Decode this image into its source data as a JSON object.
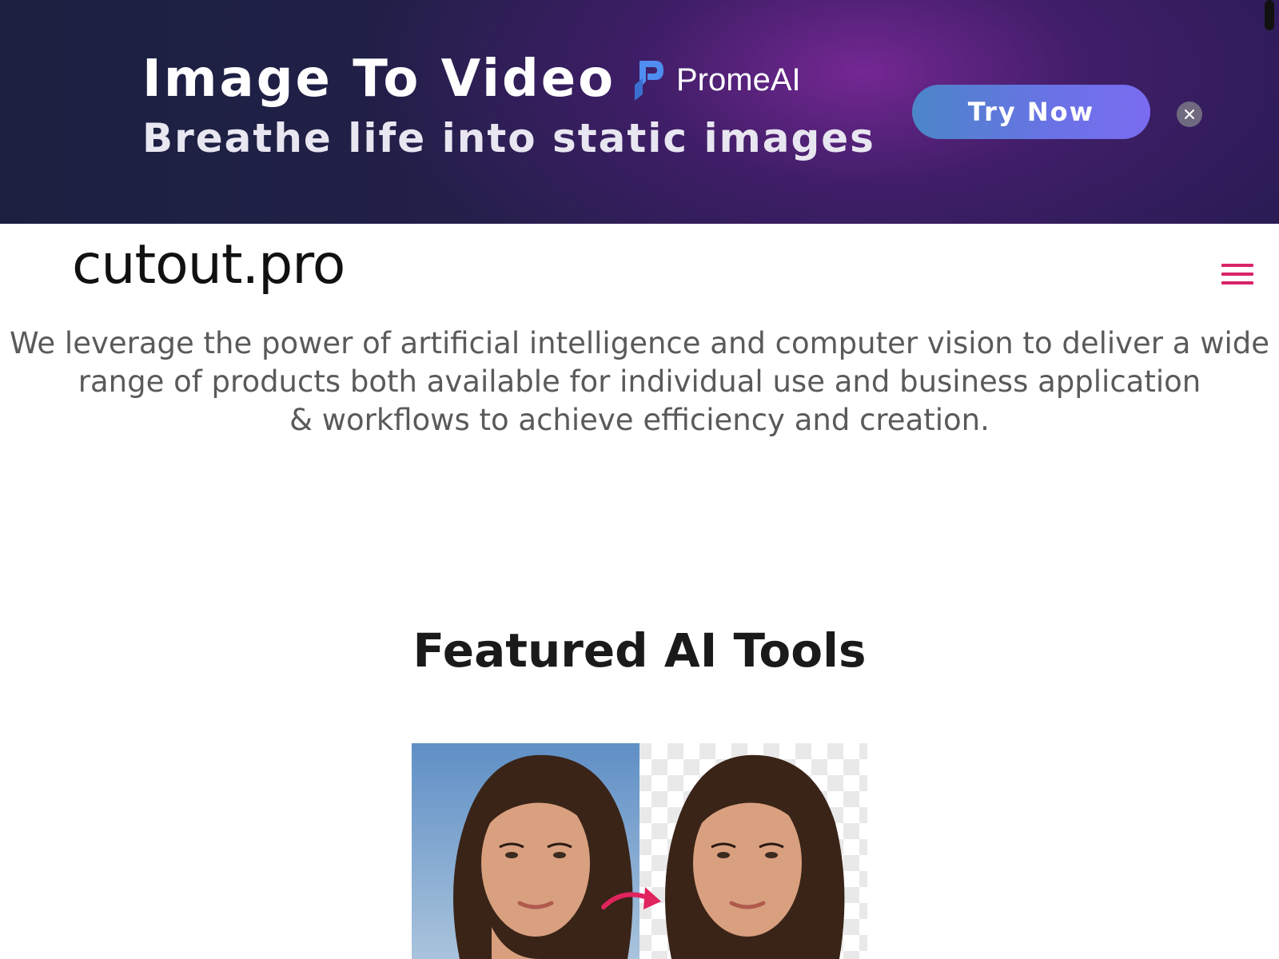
{
  "ad_banner": {
    "title": "Image To Video",
    "subtitle": "Breathe life into static images",
    "brand_name": "PromeAI",
    "cta_label": "Try Now",
    "colors": {
      "cta_start": "#4b86c8",
      "cta_end": "#7a6cf0",
      "brand_logo": "#4f8df0"
    }
  },
  "header": {
    "logo_text": "cutout.pro",
    "menu_icon": "hamburger-menu-icon",
    "menu_color": "#d8246a"
  },
  "intro": {
    "line1": "We leverage the power of artificial intelligence and computer vision to deliver a wide range of products both available for individual use and business application",
    "line2": "& workflows to achieve efficiency and creation."
  },
  "featured": {
    "heading": "Featured AI Tools"
  }
}
